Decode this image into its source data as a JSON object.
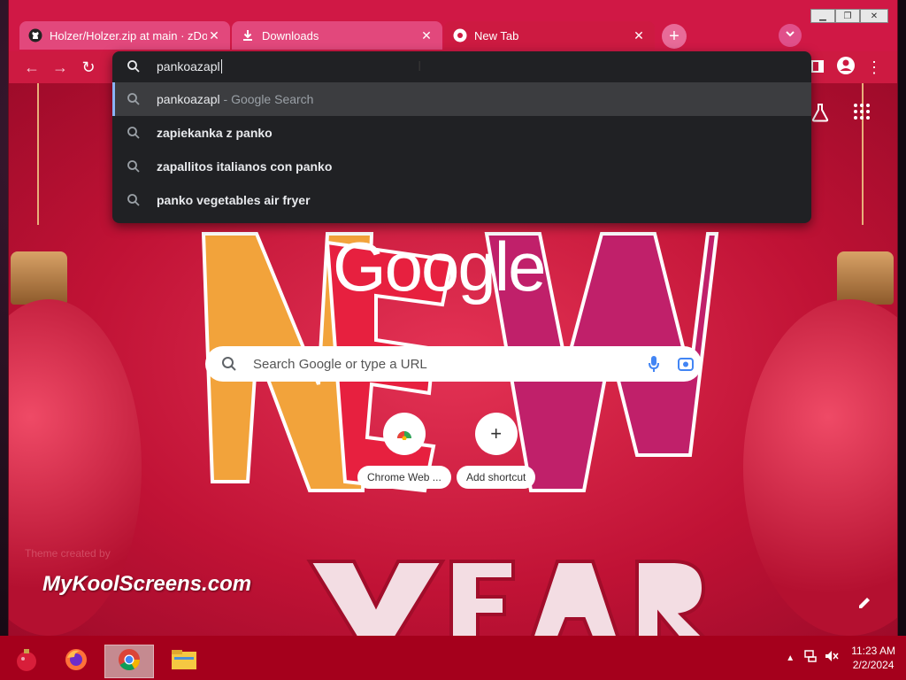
{
  "window": {
    "tabs": [
      {
        "title": "Holzer/Holzer.zip at main · zDom",
        "icon": "github-icon",
        "state": "inactive"
      },
      {
        "title": "Downloads",
        "icon": "download-icon",
        "state": "inactive"
      },
      {
        "title": "New Tab",
        "icon": "chrome-icon",
        "state": "active"
      }
    ],
    "new_tab_label": "+",
    "controls": [
      "minimize",
      "maximize",
      "close"
    ]
  },
  "omnibox": {
    "value": "pankoazapl",
    "suggestions": [
      {
        "text": "pankoazapl",
        "suffix": " - Google Search",
        "selected": true
      },
      {
        "text": "zapiekanka z panko"
      },
      {
        "text": "zapallitos italianos con panko"
      },
      {
        "text": "panko vegetables air fryer"
      }
    ]
  },
  "ntp": {
    "logo": "Google",
    "search_placeholder": "Search Google or type a URL",
    "shortcuts": [
      {
        "label": "Chrome Web ...",
        "icon": "chrome-web-store-icon"
      },
      {
        "label": "Add shortcut",
        "icon": "plus-icon"
      }
    ],
    "theme_credit": "Theme created by",
    "theme_brand": "MyKoolScreens.com",
    "background_art": "NEW YEAR"
  },
  "taskbar": {
    "apps": [
      "holiday-ornament-icon",
      "firefox-icon",
      "chrome-icon",
      "file-explorer-icon"
    ],
    "time": "11:23 AM",
    "date": "2/2/2024"
  },
  "colors": {
    "accent": "#cd1a41",
    "omnibox_bg": "#202124",
    "taskbar": "#a5001c"
  }
}
